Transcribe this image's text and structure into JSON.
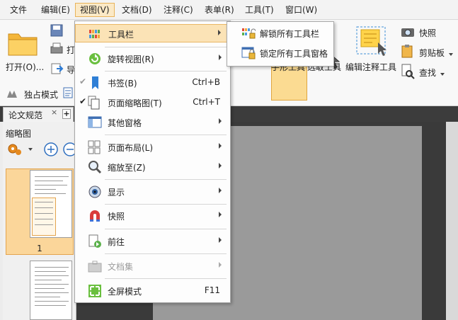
{
  "menubar": {
    "items": [
      {
        "label": "文件"
      },
      {
        "label": "编辑(E)"
      },
      {
        "label": "视图(V)"
      },
      {
        "label": "文档(D)"
      },
      {
        "label": "注释(C)"
      },
      {
        "label": "表单(R)"
      },
      {
        "label": "工具(T)"
      },
      {
        "label": "窗口(W)"
      }
    ]
  },
  "ribbon": {
    "open_label": "打开(O)...",
    "print_partial": "打",
    "partial2": "导",
    "exclusive_mode": "独占模式",
    "hand_tool_partial": "手形工具",
    "select_tool_partial": "选取工具",
    "edit_annotation_tool": "编辑注释工具",
    "snapshot": "快照",
    "clipboard": "剪贴板",
    "find": "查找"
  },
  "tabs": {
    "doc_tab_label": "论文规范",
    "close_glyph": "×",
    "new_tab_glyph": "+"
  },
  "thumbnails": {
    "header": "缩略图",
    "page1_number": "1"
  },
  "view_menu": {
    "items": [
      {
        "label": "工具栏",
        "icon": "toolbar-icon"
      },
      {
        "label": "旋转视图(R)",
        "icon": "rotate-icon"
      },
      {
        "label": "书签(B)",
        "shortcut": "Ctrl+B",
        "icon": "bookmark-icon",
        "checked": true
      },
      {
        "label": "页面缩略图(T)",
        "shortcut": "Ctrl+T",
        "icon": "thumbnails-icon",
        "checked": true
      },
      {
        "label": "其他窗格",
        "icon": "panes-icon"
      },
      {
        "label": "页面布局(L)",
        "icon": "page-layout-icon"
      },
      {
        "label": "缩放至(Z)",
        "icon": "zoom-icon"
      },
      {
        "label": "显示",
        "icon": "eye-icon"
      },
      {
        "label": "快照",
        "icon": "magnet-icon"
      },
      {
        "label": "前往",
        "icon": "goto-icon"
      },
      {
        "label": "文档集",
        "icon": "portfolio-icon",
        "disabled": true
      },
      {
        "label": "全屏模式",
        "shortcut": "F11",
        "icon": "fullscreen-icon"
      }
    ],
    "check_glyph": "✔"
  },
  "toolbar_submenu": {
    "items": [
      {
        "label": "解锁所有工具栏",
        "icon": "unlock-toolbars-icon"
      },
      {
        "label": "锁定所有工具窗格",
        "icon": "lock-panes-icon"
      }
    ]
  },
  "colors": {
    "highlight": "#fbe3b6",
    "highlight_border": "#eab766",
    "doc_background": "#3a3a3a"
  }
}
